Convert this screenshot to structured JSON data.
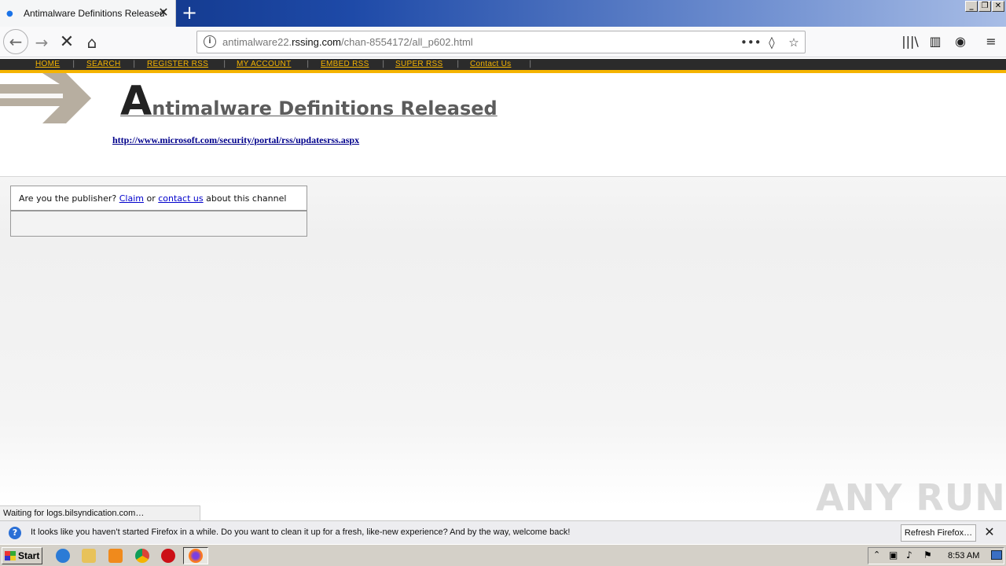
{
  "browser": {
    "tab_title": "Antimalware Definitions Released",
    "new_tab": "+",
    "url_prefix": "antimalware22.",
    "url_domain": "rssing.com",
    "url_path": "/chan-8554172/all_p602.html",
    "status_text": "Waiting for logs.bilsyndication.com…"
  },
  "site_menu": {
    "items": [
      "HOME",
      "SEARCH",
      "REGISTER RSS",
      "MY ACCOUNT",
      "EMBED RSS",
      "SUPER RSS",
      "Contact Us"
    ]
  },
  "page": {
    "title_initial": "A",
    "title_rest": "ntimalware Definitions Released",
    "feed_link": "http://www.microsoft.com/security/portal/rss/updatesrss.aspx",
    "publisher_prefix": "Are you the publisher?",
    "claim_label": "Claim",
    "or_text": "or",
    "contact_label": "contact us",
    "publisher_suffix": "about this channel"
  },
  "notification": {
    "message": "It looks like you haven’t started Firefox in a while. Do you want to clean it up for a fresh, like-new experience? And by the way, welcome back!",
    "button_label": "Refresh Firefox…"
  },
  "taskbar": {
    "start_label": "Start",
    "clock": "8:53 AM"
  },
  "watermark": "ANY RUN",
  "colors": {
    "accent_gold": "#f5b400",
    "menu_bg": "#2b2b2b",
    "link_blue": "#00008b"
  }
}
